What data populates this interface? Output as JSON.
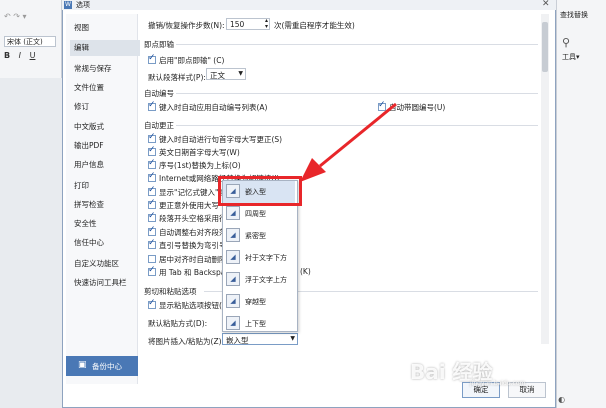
{
  "app": {
    "title": "选项",
    "left_toolbar": {
      "font_name": "宋体 (正文)",
      "bold": "B",
      "italic": "I",
      "underline": "U"
    },
    "right_toolbar": {
      "find_replace": "查找替换",
      "tools": "工具"
    }
  },
  "sidebar": {
    "items": [
      {
        "label": "视图"
      },
      {
        "label": "编辑"
      },
      {
        "label": "常规与保存"
      },
      {
        "label": "文件位置"
      },
      {
        "label": "修订"
      },
      {
        "label": "中文版式"
      },
      {
        "label": "输出PDF"
      },
      {
        "label": "用户信息"
      },
      {
        "label": "打印"
      },
      {
        "label": "拼写检查"
      },
      {
        "label": "安全性"
      },
      {
        "label": "信任中心"
      },
      {
        "label": "自定义功能区"
      },
      {
        "label": "快速访问工具栏"
      }
    ],
    "backup_label": "备份中心"
  },
  "undo": {
    "label": "撤销/恢复操作步数(N):",
    "value": "150",
    "hint": "次(需重启程序才能生效)"
  },
  "instant_input": {
    "title": "即点即输",
    "enable_label": "启用\"即点即输\" (C)",
    "style_label": "默认段落样式(P):",
    "style_value": "正文"
  },
  "auto_numbering": {
    "title": "自动编号",
    "list_label": "键入时自动应用自动编号列表(A)",
    "circle_label": "自动带圆编号(U)"
  },
  "auto_correct": {
    "title": "自动更正",
    "items": [
      {
        "label": "键入时自动进行句首字母大写更正(S)",
        "checked": true
      },
      {
        "label": "英文日期首字母大写(W)",
        "checked": true
      },
      {
        "label": "序号(1st)替换为上标(O)",
        "checked": true
      },
      {
        "label": "Internet或网络路径替换为超链接(I)",
        "checked": true
      },
      {
        "label": "显示\"记忆式键入\"建",
        "checked": true
      },
      {
        "label": "更正意外使用大写",
        "checked": true
      },
      {
        "label": "段落开头空格采用行",
        "checked": true
      },
      {
        "label": "自动调整右对齐段落",
        "checked": true
      },
      {
        "label": "直引号替换为弯引号",
        "checked": true
      },
      {
        "label": "居中对齐时自动删除",
        "checked": false
      },
      {
        "label": "用 Tab 和 Backspa",
        "checked": true
      }
    ],
    "tab_suffix": "(K)"
  },
  "cut_paste": {
    "title": "剪切和粘贴选项",
    "show_paste_label": "显示粘贴选项按钮(T",
    "default_paste_label": "默认粘贴方式(D):",
    "image_insert_label": "将图片插入/粘贴为(Z):",
    "image_insert_value": "嵌入型"
  },
  "dropdown": {
    "options": [
      {
        "icon": "inline-wrap-icon",
        "label": "嵌入型"
      },
      {
        "icon": "square-wrap-icon",
        "label": "四周型"
      },
      {
        "icon": "tight-wrap-icon",
        "label": "紧密型"
      },
      {
        "icon": "behind-text-icon",
        "label": "衬于文字下方"
      },
      {
        "icon": "in-front-text-icon",
        "label": "浮于文字上方"
      },
      {
        "icon": "through-wrap-icon",
        "label": "穿越型"
      },
      {
        "icon": "top-bottom-wrap-icon",
        "label": "上下型"
      }
    ],
    "highlighted_color": "#e8262a"
  },
  "buttons": {
    "ok": "确定",
    "cancel": "取消"
  },
  "watermark": {
    "text": "Bai 经验",
    "sub": "jingyan.baidu.com"
  },
  "colors": {
    "accent": "#4a78b5",
    "annotation_red": "#e8262a"
  }
}
